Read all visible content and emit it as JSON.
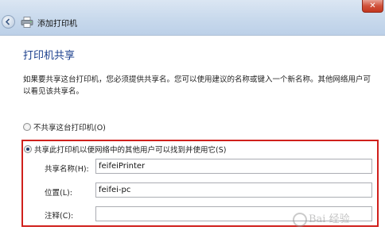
{
  "window": {
    "title": "添加打印机",
    "close_glyph": "✕",
    "icon_name": "printer-icon"
  },
  "page": {
    "heading": "打印机共享",
    "description": "如果要共享这台打印机，您必须提供共享名。您可以使用建议的名称或键入一个新名称。其他网络用户可以看见该共享名。"
  },
  "options": {
    "no_share": {
      "label": "不共享这台打印机(O)",
      "checked": false
    },
    "share": {
      "label": "共享此打印机以便网络中的其他用户可以找到并使用它(S)",
      "checked": true
    }
  },
  "fields": {
    "share_name": {
      "label": "共享名称(H):",
      "value": "feifeiPrinter"
    },
    "location": {
      "label": "位置(L):",
      "value": "feifei-pc"
    },
    "comment": {
      "label": "注释(C):",
      "value": ""
    }
  },
  "watermark": {
    "text": "Bai 经验"
  },
  "colors": {
    "highlight": "#d0201c",
    "heading": "#1a3e8c"
  }
}
